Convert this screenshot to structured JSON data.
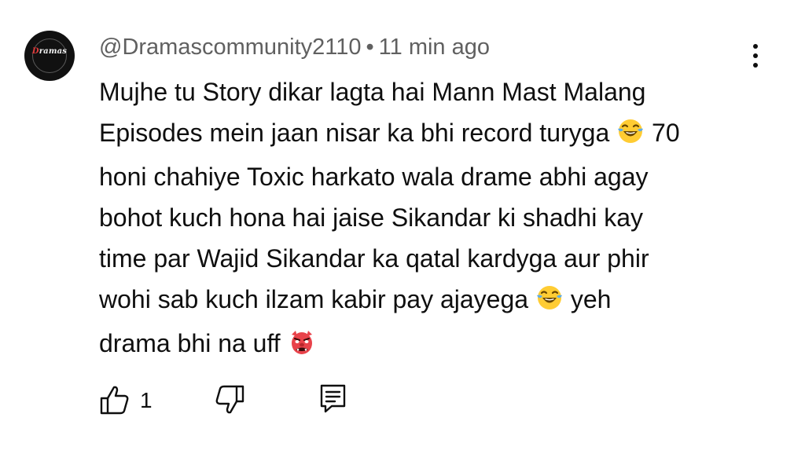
{
  "comment": {
    "avatar": {
      "text_first": "D",
      "text_rest": "ramas"
    },
    "author": "@Dramascommunity2110",
    "separator": "•",
    "time": "11 min ago",
    "lines": [
      "Mujhe tu Story dikar lagta hai Mann Mast Malang",
      "Episodes mein jaan nisar ka bhi record turyga",
      "70",
      "honi chahiye Toxic harkato wala drame abhi agay",
      "bohot kuch hona hai jaise Sikandar ki shadhi kay",
      "time par Wajid Sikandar ka qatal kardyga aur phir",
      "wohi sab kuch ilzam kabir pay ajayega",
      "yeh",
      "drama bhi na uff"
    ],
    "emojis": [
      "face-with-tears-of-joy",
      "face-with-tears-of-joy",
      "goblin-mask"
    ],
    "like_count": "1"
  },
  "icons": {
    "like": "thumbs-up-icon",
    "dislike": "thumbs-down-icon",
    "reply": "reply-comment-icon",
    "menu": "more-vertical-icon"
  },
  "colors": {
    "background": "#ffffff",
    "text": "#0f0f0f",
    "meta": "#606060",
    "goblin": "#e8424a"
  }
}
